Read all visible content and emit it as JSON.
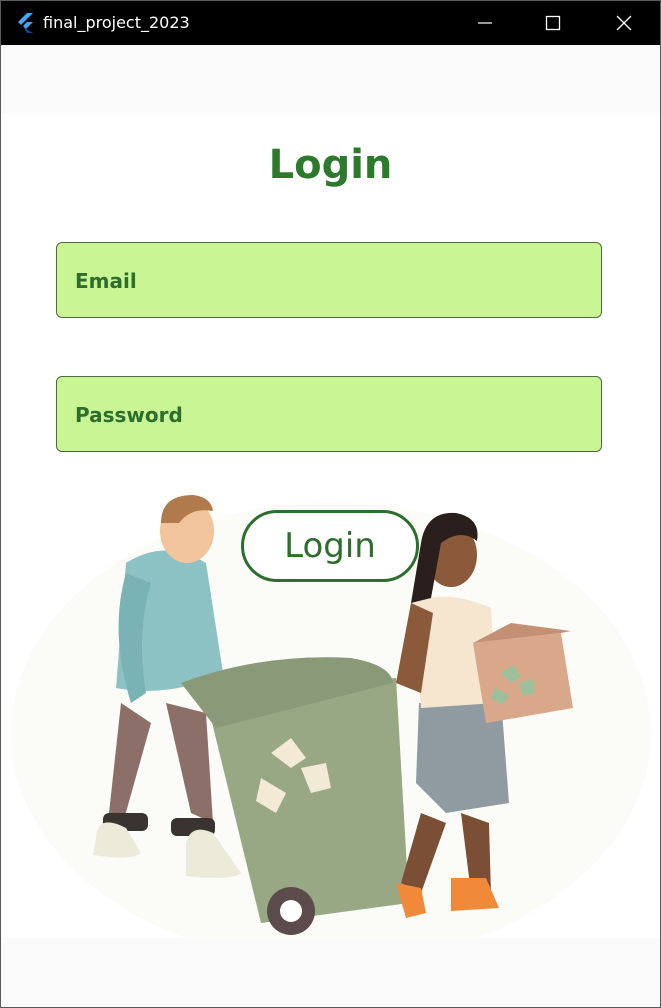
{
  "window": {
    "title": "final_project_2023",
    "icon": "flutter-icon",
    "controls": [
      "minimize-icon",
      "maximize-icon",
      "close-icon"
    ]
  },
  "page": {
    "title": "Login",
    "email_label": "Email",
    "password_label": "Password",
    "login_button": "Login",
    "illustration": "recycling-people-illustration"
  },
  "colors": {
    "title_bar": "#000000",
    "accent_green": "#2d7a2d",
    "field_fill": "#c9f595",
    "field_border": "#4d6b3a",
    "band": "#fafafa"
  }
}
